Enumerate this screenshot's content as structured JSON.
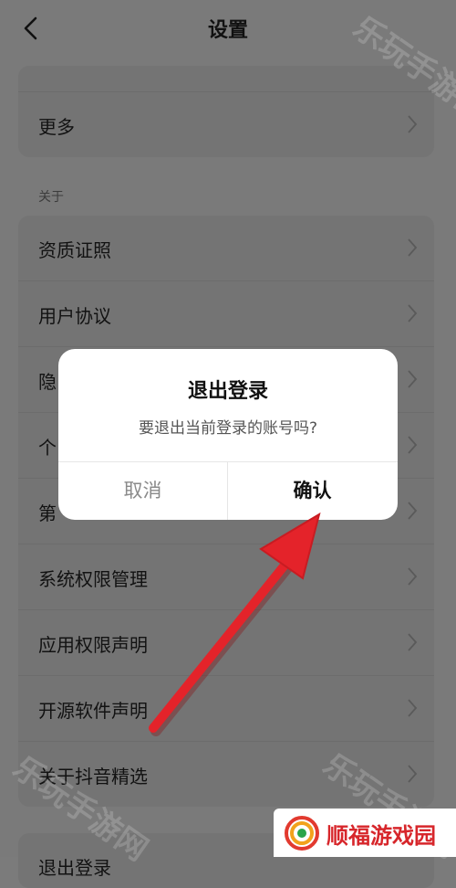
{
  "header": {
    "title": "设置"
  },
  "cards": {
    "top": {
      "items": [
        {
          "label": "更多"
        }
      ]
    },
    "about": {
      "section_label": "关于",
      "items": [
        {
          "label": "资质证照"
        },
        {
          "label": "用户协议"
        },
        {
          "label": "隐"
        },
        {
          "label": "个"
        },
        {
          "label": "第"
        },
        {
          "label": "系统权限管理"
        },
        {
          "label": "应用权限声明"
        },
        {
          "label": "开源软件声明"
        },
        {
          "label": "关于抖音精选"
        }
      ]
    },
    "bottom": {
      "items": [
        {
          "label": "退出登录"
        }
      ]
    }
  },
  "dialog": {
    "title": "退出登录",
    "message": "要退出当前登录的账号吗?",
    "cancel": "取消",
    "confirm": "确认"
  },
  "watermark": {
    "text": "乐玩手游网"
  },
  "brand": {
    "text": "顺福游戏园"
  },
  "colors": {
    "arrow": "#e4232a",
    "brand_text": "#d7262b"
  },
  "icons": {
    "back": "back-arrow-icon",
    "chevron": "chevron-right-icon"
  }
}
